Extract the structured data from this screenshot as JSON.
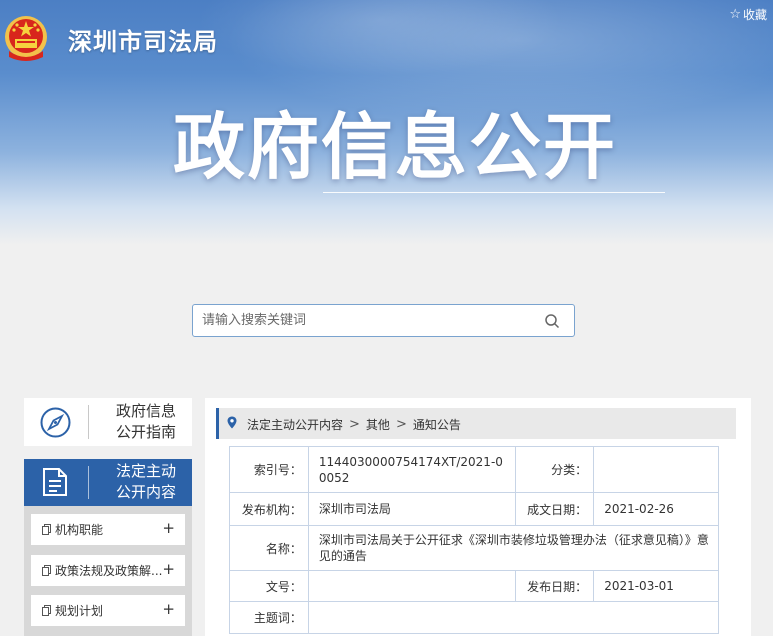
{
  "header": {
    "org_name": "深圳市司法局",
    "favorite_label": "收藏",
    "banner_title": "政府信息公开"
  },
  "search": {
    "placeholder": "请输入搜索关键词"
  },
  "sidebar": {
    "guide_line1": "政府信息",
    "guide_line2": "公开指南",
    "active_line1": "法定主动",
    "active_line2": "公开内容",
    "items": [
      {
        "label": "机构职能",
        "expand": "+"
      },
      {
        "label": "政策法规及政策解...",
        "expand": "+"
      },
      {
        "label": "规划计划",
        "expand": "+"
      }
    ]
  },
  "breadcrumb": {
    "items": [
      "法定主动公开内容",
      "其他",
      "通知公告"
    ],
    "separator": ">"
  },
  "info_table": {
    "index_label": "索引号：",
    "index_value": "1144030000754174XT/2021-00052",
    "category_label": "分类：",
    "category_value": "",
    "publisher_label": "发布机构：",
    "publisher_value": "深圳市司法局",
    "created_label": "成文日期：",
    "created_value": "2021-02-26",
    "name_label": "名称：",
    "name_value": "深圳市司法局关于公开征求《深圳市装修垃圾管理办法（征求意见稿）》意见的通告",
    "docno_label": "文号：",
    "docno_value": "",
    "published_label": "发布日期：",
    "published_value": "2021-03-01",
    "subject_label": "主题词：",
    "subject_value": ""
  },
  "colors": {
    "accent": "#2c62a8",
    "banner_top": "#4c7fc4",
    "table_border": "#c7d4e6"
  }
}
